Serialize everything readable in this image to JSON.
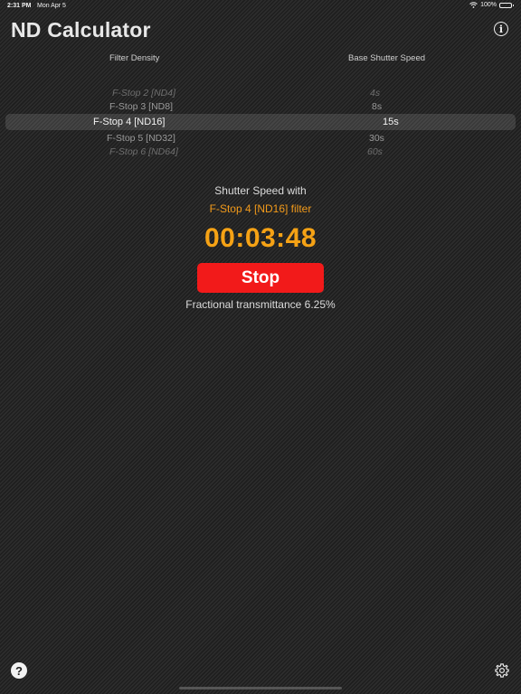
{
  "status_bar": {
    "time": "2:31 PM",
    "date": "Mon Apr 5",
    "battery": "100%",
    "icons": [
      "wifi-icon",
      "battery-icon"
    ]
  },
  "app": {
    "title": "ND Calculator"
  },
  "picker": {
    "filter_header": "Filter Density",
    "shutter_header": "Base Shutter Speed",
    "filter_items": [
      "F-Stop 2 [ND4]",
      "F-Stop 3 [ND8]",
      "F-Stop 4 [ND16]",
      "F-Stop 5 [ND32]",
      "F-Stop 6 [ND64]"
    ],
    "shutter_items": [
      "4s",
      "8s",
      "15s",
      "30s",
      "60s"
    ],
    "selected_filter": "F-Stop 4 [ND16]",
    "selected_shutter": "15s"
  },
  "result": {
    "label": "Shutter Speed with",
    "filter_text": "F-Stop 4 [ND16] filter",
    "timer": "00:03:48",
    "stop_label": "Stop",
    "transmittance": "Fractional transmittance 6.25%"
  },
  "colors": {
    "accent": "#f5a215",
    "stop": "#f21a1a"
  },
  "icons": {
    "info": "info-icon",
    "help": "question-icon",
    "settings": "gear-icon"
  }
}
